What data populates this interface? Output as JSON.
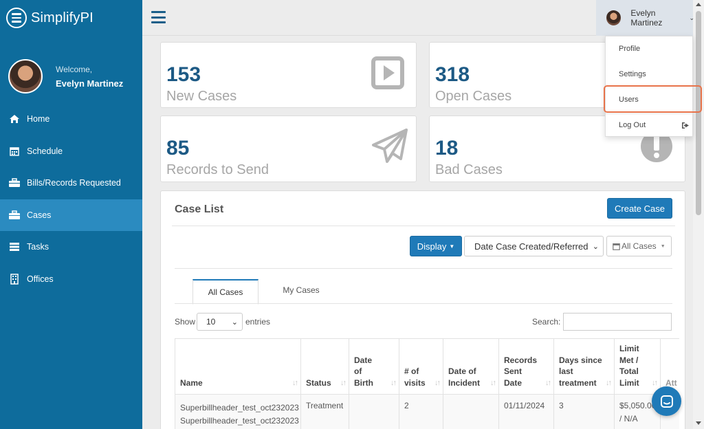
{
  "brand": {
    "name": "SimplifyPI"
  },
  "sidebar": {
    "welcome_label": "Welcome,",
    "user_name": "Evelyn Martinez",
    "items": [
      {
        "label": "Home",
        "icon": "home-icon"
      },
      {
        "label": "Schedule",
        "icon": "calendar-icon"
      },
      {
        "label": "Bills/Records Requested",
        "icon": "toolbox-icon"
      },
      {
        "label": "Cases",
        "icon": "briefcase-icon"
      },
      {
        "label": "Tasks",
        "icon": "list-icon"
      },
      {
        "label": "Offices",
        "icon": "building-icon"
      }
    ],
    "active": "Cases"
  },
  "topbar": {
    "user_name": "Evelyn Martinez"
  },
  "stats": [
    {
      "value": "153",
      "label": "New Cases",
      "icon": "play-icon"
    },
    {
      "value": "318",
      "label": "Open Cases",
      "icon": "folder-icon"
    },
    {
      "value": "85",
      "label": "Records to Send",
      "icon": "paper-plane-icon"
    },
    {
      "value": "18",
      "label": "Bad Cases",
      "icon": "exclamation-icon"
    }
  ],
  "user_dropdown": {
    "items": [
      "Profile",
      "Settings",
      "Users",
      "Log Out"
    ],
    "highlighted": "Users"
  },
  "case_list": {
    "title": "Case List",
    "create_button": "Create Case",
    "display_button": "Display",
    "date_filter": "Date Case Created/Referred",
    "scope_filter": "All Cases",
    "tabs": [
      "All Cases",
      "My Cases"
    ],
    "active_tab": "All Cases",
    "show_label": "Show",
    "entries_value": "10",
    "entries_label": "entries",
    "search_label": "Search:",
    "columns": [
      "Name",
      "Status",
      "Date of Birth",
      "# of visits",
      "Date of Incident",
      "Records Sent Date",
      "Days since last treatment",
      "Limit Met / Total Limit",
      "Att"
    ],
    "rows": [
      {
        "name_line1": "Superbillheader_test_oct232023",
        "name_line2": "Superbillheader_test_oct232023",
        "status": "Treatment",
        "dob": "",
        "visits": "2",
        "incident": "",
        "records_sent": "01/11/2024",
        "days_since": "3",
        "limit": "$5,050.00 / N/A"
      }
    ]
  },
  "colors": {
    "sidebar": "#0e6c9c",
    "sidebar_active": "#2b8bc0",
    "primary": "#1f7ab8",
    "stat_number": "#1d5a85",
    "highlight": "#e8734a"
  }
}
